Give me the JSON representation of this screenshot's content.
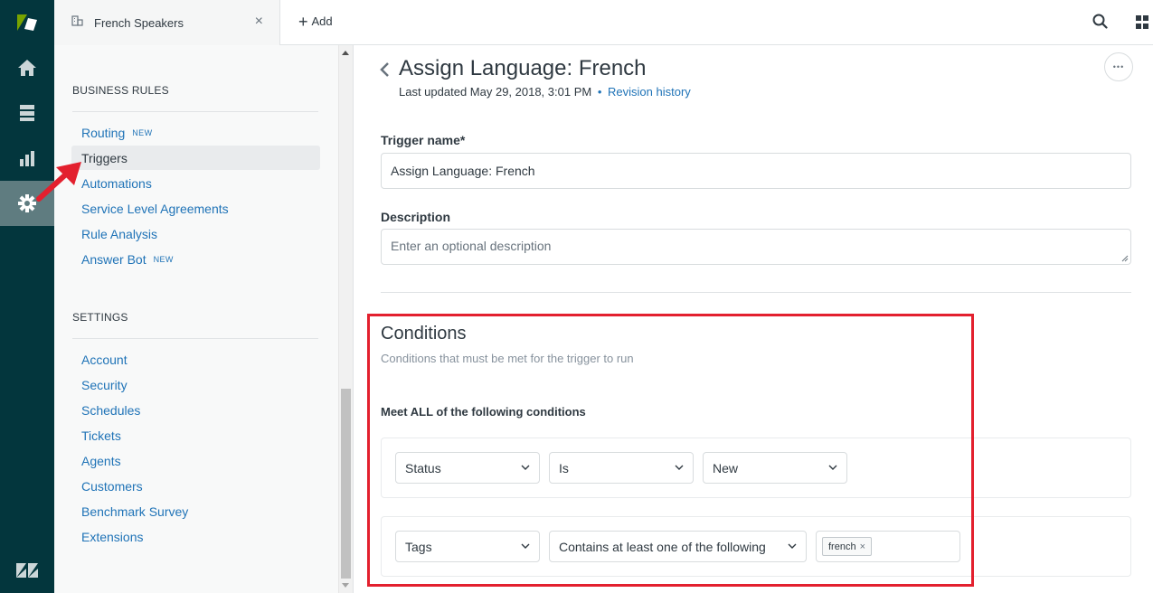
{
  "topbar": {
    "tab_label": "French Speakers",
    "tab_close": "×",
    "add_label": "Add"
  },
  "sidebar": {
    "business_rules_heading": "BUSINESS RULES",
    "business_rules": [
      {
        "label": "Routing",
        "badge": "NEW"
      },
      {
        "label": "Triggers",
        "badge": ""
      },
      {
        "label": "Automations",
        "badge": ""
      },
      {
        "label": "Service Level Agreements",
        "badge": ""
      },
      {
        "label": "Rule Analysis",
        "badge": ""
      },
      {
        "label": "Answer Bot",
        "badge": "NEW"
      }
    ],
    "settings_heading": "SETTINGS",
    "settings": [
      {
        "label": "Account"
      },
      {
        "label": "Security"
      },
      {
        "label": "Schedules"
      },
      {
        "label": "Tickets"
      },
      {
        "label": "Agents"
      },
      {
        "label": "Customers"
      },
      {
        "label": "Benchmark Survey"
      },
      {
        "label": "Extensions"
      }
    ]
  },
  "main": {
    "title": "Assign Language: French",
    "last_updated": "Last updated May 29, 2018, 3:01 PM",
    "meta_dot": "•",
    "revision_link": "Revision history",
    "more_glyph": "•••",
    "trigger_name_label": "Trigger name*",
    "trigger_name_value": "Assign Language: French",
    "description_label": "Description",
    "description_placeholder": "Enter an optional description",
    "conditions": {
      "title": "Conditions",
      "subtitle": "Conditions that must be met for the trigger to run",
      "meet_all": "Meet ALL of the following conditions",
      "rows": [
        {
          "field": "Status",
          "operator": "Is",
          "value": "New"
        },
        {
          "field": "Tags",
          "operator": "Contains at least one of the following",
          "tag": "french",
          "tag_remove": "×"
        }
      ]
    }
  },
  "icons": {
    "rail": [
      "zendesk-logo-icon",
      "home-icon",
      "views-icon",
      "reporting-icon",
      "admin-gear-icon",
      "zendesk-z-icon"
    ]
  },
  "colors": {
    "rail_bg": "#03363d",
    "rail_active": "#5f7c80",
    "link": "#1f73b7",
    "highlight": "#e3202e",
    "logo_green": "#78a300"
  }
}
